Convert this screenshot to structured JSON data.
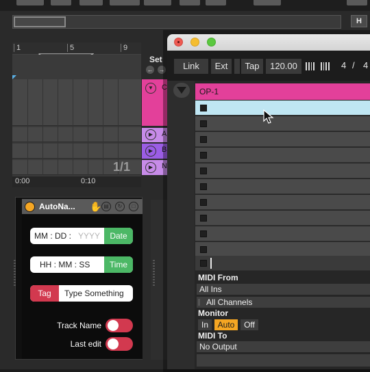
{
  "arrangement": {
    "bar_numbers": [
      "1",
      "5",
      "9"
    ],
    "set_label": "Set",
    "overview_button": "H",
    "clip_ratio": "1/1",
    "time_labels": [
      "0:00",
      "0:10"
    ],
    "clip_labels": [
      "C",
      "A",
      "B",
      "N"
    ]
  },
  "device": {
    "title": "AutoNa...",
    "date_field": {
      "placeholder_dim": "YYYY",
      "placeholder_main": "MM : DD : ",
      "button": "Date"
    },
    "time_field": {
      "placeholder": "HH : MM : SS",
      "button": "Time"
    },
    "tag_field": {
      "button": "Tag",
      "text": "Type Something"
    },
    "toggles": [
      {
        "label": "Track Name",
        "on": true
      },
      {
        "label": "Last edit",
        "on": true
      }
    ]
  },
  "window": {
    "toolbar": {
      "link": "Link",
      "ext": "Ext",
      "tap": "Tap",
      "tempo": "120.00",
      "sig_num": "4",
      "sig_sep": "/",
      "sig_den": "4"
    },
    "track_name": "OP-1",
    "track_color": "#e3409a",
    "io": {
      "midi_from_label": "MIDI From",
      "midi_from_value": "All Ins",
      "channel_value": "All Channels",
      "monitor_label": "Monitor",
      "monitor_options": [
        "In",
        "Auto",
        "Off"
      ],
      "monitor_selected": "Auto",
      "midi_to_label": "MIDI To",
      "midi_to_value": "No Output"
    }
  }
}
